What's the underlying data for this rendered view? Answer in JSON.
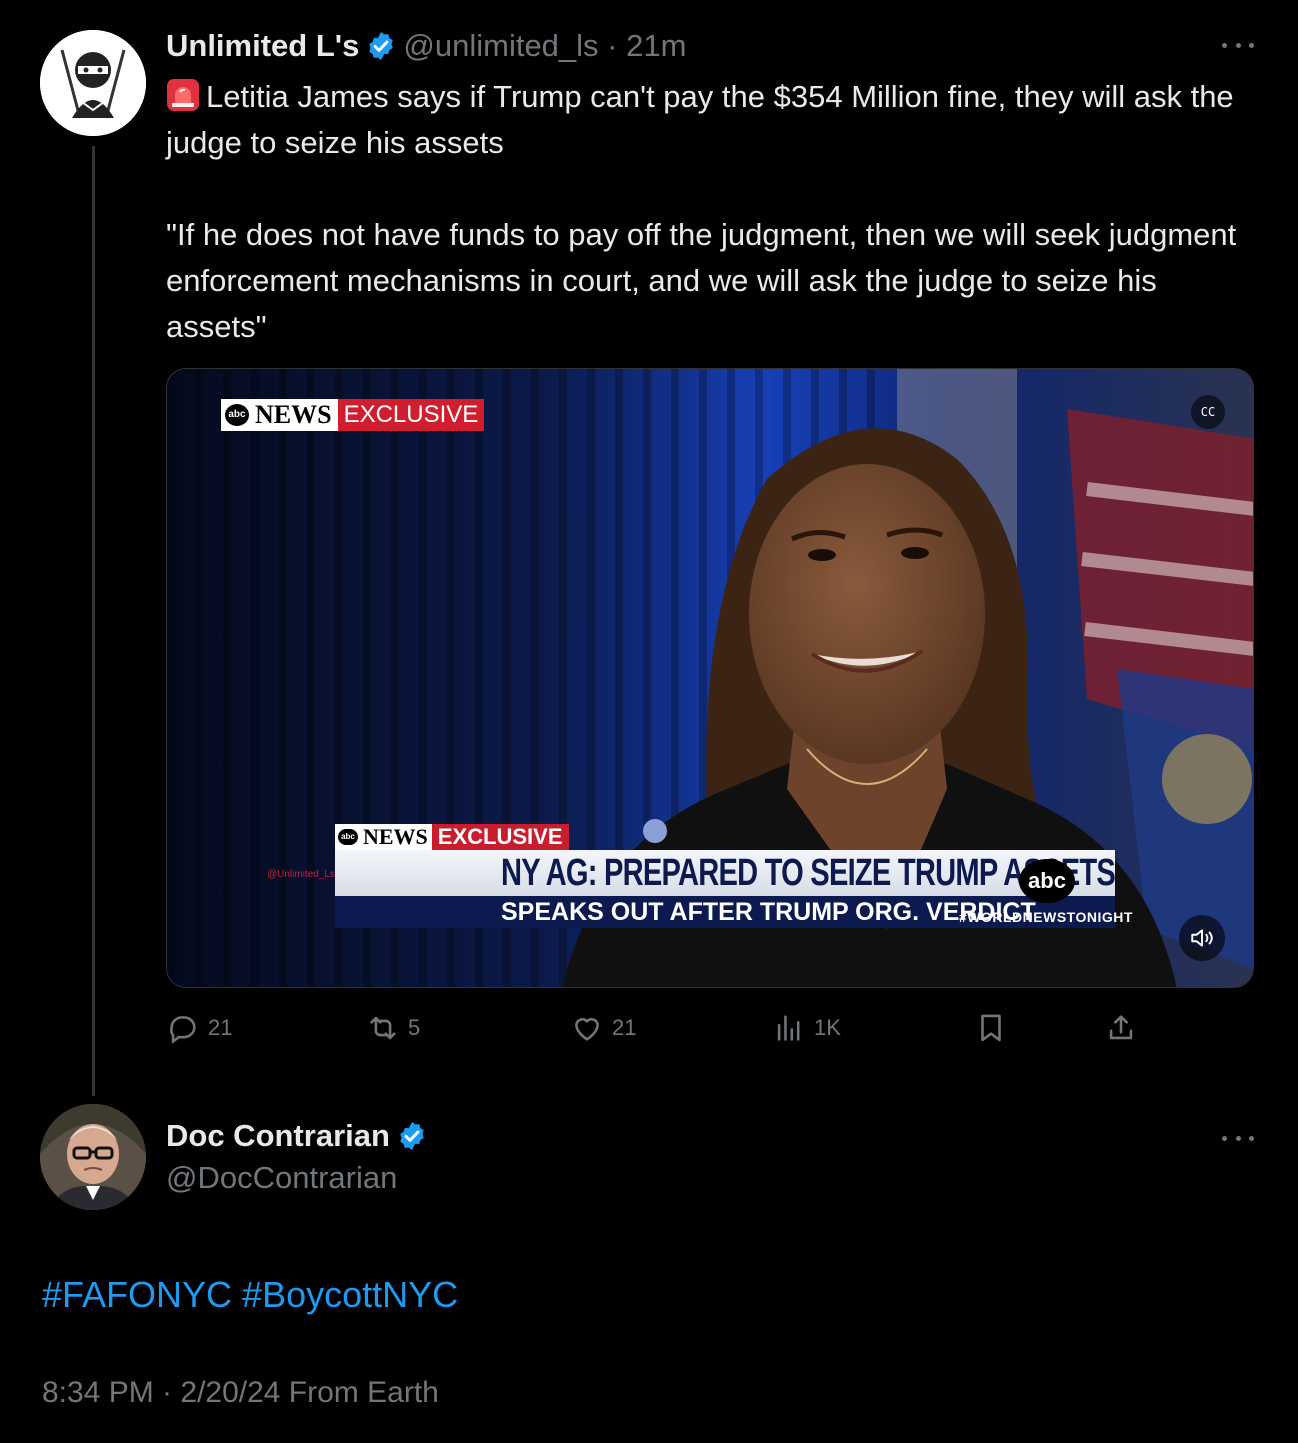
{
  "tweet": {
    "author_name": "Unlimited L's",
    "handle": "@unlimited_ls",
    "time": "21m",
    "text_line1": "Letitia James says if Trump can't pay the $354 Million fine, they will ask the judge to seize his assets",
    "text_quote": "\"If he does not have funds to pay off the judgment, then we will seek judgment enforcement mechanisms in court, and we will ask the judge to seize his assets\"",
    "icons": [
      "siren-emoji-icon",
      "verified-badge-icon",
      "more-options-icon"
    ],
    "media": {
      "top_brand": "NEWS",
      "top_tag": "EXCLUSIVE",
      "lower_brand": "NEWS",
      "lower_tag": "EXCLUSIVE",
      "headline": "NY AG: PREPARED TO SEIZE TRUMP ASSETS",
      "subheadline": "SPEAKS OUT AFTER TRUMP ORG. VERDICT",
      "network_bug": "abc",
      "hashtag": "#WORLDNEWSTONIGHT",
      "watermark": "@Unlimited_Ls",
      "cc_label": "CC"
    },
    "actions": {
      "replies": "21",
      "reposts": "5",
      "likes": "21",
      "views": "1K"
    }
  },
  "reply": {
    "author_name": "Doc Contrarian",
    "handle": "@DocContrarian",
    "hashtag1": "#FAFONYC",
    "hashtag2": "#BoycottNYC",
    "meta": "8:34 PM · 2/20/24 From Earth"
  },
  "colors": {
    "background": "#000000",
    "text": "#e7e9ea",
    "secondary": "#71767b",
    "link": "#1d9bf0",
    "verified": "#1d9bf0"
  }
}
